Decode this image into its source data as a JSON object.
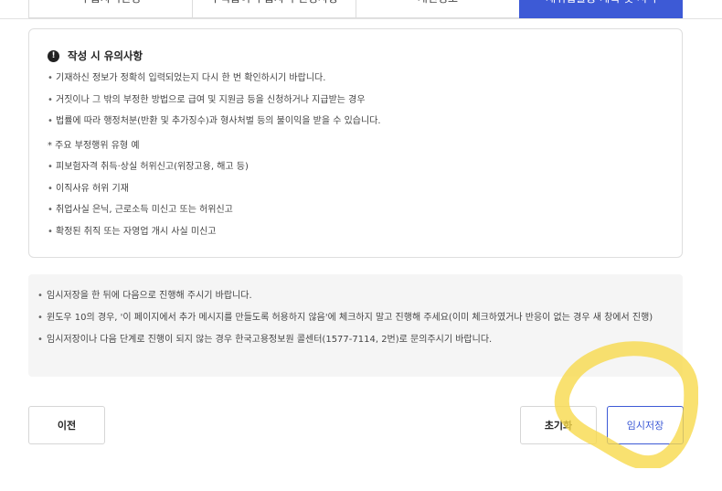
{
  "tabs": [
    {
      "label": "수급자격신청"
    },
    {
      "label": "구직급여 수급자격 인정사항"
    },
    {
      "label": "개인정보"
    },
    {
      "label": "재취업활동 계획 및 서약"
    }
  ],
  "caution": {
    "title": "작성 시 유의사항",
    "lines": [
      "기재하신 정보가 정확히 입력되었는지 다시 한 번 확인하시기 바랍니다.",
      "거짓이나 그 밖의 부정한 방법으로 급여 및 지원금 등을 신청하거나 지급받는 경우",
      "법률에 따라 행정처분(반환 및 추가징수)과 형사처벌 등의 불이익을 받을 수 있습니다."
    ],
    "examples_heading": "* 주요 부정행위 유형 예",
    "examples": [
      "피보험자격 취득·상실 허위신고(위장고용, 해고 등)",
      "이직사유 허위 기재",
      "취업사실 은닉, 근로소득 미신고 또는 허위신고",
      "확정된 취직 또는 자영업 개시 사실 미신고"
    ]
  },
  "notes": [
    "임시저장을 한 뒤에 다음으로 진행해 주시기 바랍니다.",
    "윈도우 10의 경우, '이 페이지에서 추가 메시지를 만들도록 허용하지 않음'에 체크하지 말고 진행해 주세요(이미 체크하였거나 반응이 없는 경우 새 창에서 진행)",
    "임시저장이나 다음 단계로 진행이 되지 않는 경우 한국고용정보원 콜센터(1577-7114, 2번)로 문의주시기 바랍니다."
  ],
  "buttons": {
    "prev": "이전",
    "reset": "초기화",
    "save": "임시저장"
  },
  "colors": {
    "accent": "#3d5ad6",
    "highlight": "#f7d94c"
  },
  "icons": {
    "caution": "exclamation-circle-icon"
  }
}
